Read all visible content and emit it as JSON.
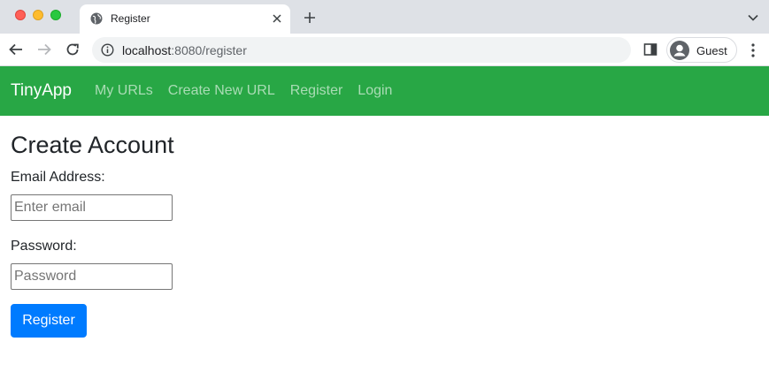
{
  "browser": {
    "tab": {
      "title": "Register",
      "favicon": "globe-icon"
    },
    "address": {
      "host": "localhost",
      "rest": ":8080/register"
    },
    "profile": {
      "name": "Guest"
    },
    "icons": {
      "back": "arrow-left-icon",
      "forward": "arrow-right-icon",
      "reload": "reload-icon",
      "info": "info-icon",
      "new_tab": "plus-icon",
      "tab_search": "chevron-down-icon",
      "side_panel": "side-panel-icon",
      "menu": "kebab-menu-icon"
    }
  },
  "navbar": {
    "brand": "TinyApp",
    "color": "#28a745",
    "links": [
      "My URLs",
      "Create New URL",
      "Register",
      "Login"
    ]
  },
  "form": {
    "title": "Create Account",
    "email_label": "Email Address:",
    "email_placeholder": "Enter email",
    "email_value": "",
    "password_label": "Password:",
    "password_placeholder": "Password",
    "password_value": "",
    "submit_label": "Register",
    "submit_color": "#007bff"
  }
}
